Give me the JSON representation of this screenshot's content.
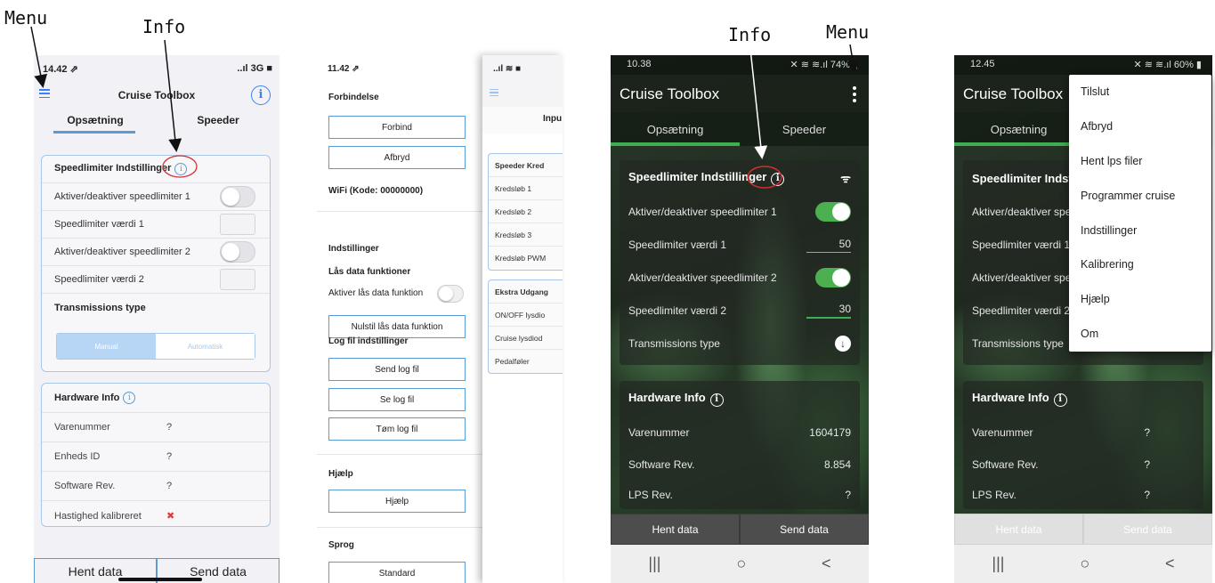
{
  "annotations": {
    "menu_left": "Menu",
    "info_left": "Info",
    "info_right": "Info",
    "menu_right": "Menu"
  },
  "ios_main": {
    "status_time": "14.42 ⇗",
    "status_right": "..ıl 3G ■",
    "title": "Cruise Toolbox",
    "tabs": [
      "Opsætning",
      "Speeder"
    ],
    "speed_section": {
      "title": "Speedlimiter Indstillinger",
      "rows": [
        "Aktiver/deaktiver speedlimiter 1",
        "Speedlimiter værdi 1",
        "Aktiver/deaktiver speedlimiter 2",
        "Speedlimiter værdi 2"
      ],
      "transmission_title": "Transmissions type",
      "seg_manual": "Manual",
      "seg_auto": "Automatisk"
    },
    "hardware": {
      "title": "Hardware Info",
      "rows": [
        {
          "label": "Varenummer",
          "value": "?"
        },
        {
          "label": "Enheds ID",
          "value": "?"
        },
        {
          "label": "Software Rev.",
          "value": "?"
        },
        {
          "label": "Hastighed kalibreret",
          "value": "✖"
        }
      ]
    },
    "buttons": {
      "fetch": "Hent data",
      "send": "Send data"
    }
  },
  "ios_settings": {
    "status_time": "11.42 ⇗",
    "status_right": "..ıl ≋ ■",
    "connection_title": "Forbindelse",
    "connect": "Forbind",
    "disconnect": "Afbryd",
    "wifi_label": "WiFi (Kode: 00000000)",
    "settings_title": "Indstillinger",
    "lock_title": "Lås data funktioner",
    "lock_toggle_label": "Aktiver lås data funktion",
    "reset_lock": "Nulstil lås data funktion",
    "log_title": "Log fil indstillinger",
    "send_log": "Send log fil",
    "view_log": "Se log fil",
    "clear_log": "Tøm log fil",
    "help_title": "Hjælp",
    "help_button": "Hjælp",
    "language_title": "Sprog",
    "language_button": "Standard"
  },
  "ios_overlay": {
    "tab_partial": "Inpu",
    "card1_title": "Speeder Kred",
    "card1_rows": [
      "Kredsløb 1",
      "Kredsløb 2",
      "Kredsløb 3",
      "Kredsløb PWM"
    ],
    "card2_title": "Ekstra Udgang",
    "card2_rows": [
      "ON/OFF lysdio",
      "Cruise lysdiod",
      "Pedalføler"
    ]
  },
  "android_main": {
    "status_time": "10.38",
    "status_right": "✕ ≋ ≋.ıl 74% ▮",
    "title": "Cruise Toolbox",
    "tabs": [
      "Opsætning",
      "Speeder"
    ],
    "speed_title": "Speedlimiter Indstillinger",
    "rows": [
      {
        "label": "Aktiver/deaktiver speedlimiter 1"
      },
      {
        "label": "Speedlimiter værdi 1",
        "value": "50"
      },
      {
        "label": "Aktiver/deaktiver speedlimiter 2"
      },
      {
        "label": "Speedlimiter værdi 2",
        "value": "30"
      },
      {
        "label": "Transmissions type"
      }
    ],
    "hardware_title": "Hardware Info",
    "hardware_rows": [
      {
        "label": "Varenummer",
        "value": "1604179"
      },
      {
        "label": "Software Rev.",
        "value": "8.854"
      },
      {
        "label": "LPS Rev.",
        "value": "?"
      }
    ],
    "buttons": {
      "fetch": "Hent data",
      "send": "Send data"
    }
  },
  "android_menu": {
    "status_time": "12.45",
    "status_right": "✕ ≋ ≋.ıl 60% ▮",
    "title": "Cruise Toolbox",
    "tab": "Opsætning",
    "speed_title": "Speedlimiter Indsti",
    "rows": [
      "Aktiver/deaktiver spe",
      "Speedlimiter værdi 1",
      "Aktiver/deaktiver spe",
      "Speedlimiter værdi 2",
      "Transmissions type"
    ],
    "hardware_title": "Hardware Info",
    "hardware_rows": [
      {
        "label": "Varenummer",
        "value": "?"
      },
      {
        "label": "Software Rev.",
        "value": "?"
      },
      {
        "label": "LPS Rev.",
        "value": "?"
      }
    ],
    "buttons": {
      "fetch": "Hent data",
      "send": "Send data"
    },
    "menu_items": [
      "Tilslut",
      "Afbryd",
      "Hent lps filer",
      "Programmer cruise",
      "Indstillinger",
      "Kalibrering",
      "Hjælp",
      "Om"
    ]
  },
  "nav_glyphs": {
    "recents": "|||",
    "home": "○",
    "back": "<"
  },
  "colors": {
    "ios_accent": "#3b82f6",
    "android_green": "#4caf50",
    "annotation_red": "#d32f2f"
  }
}
